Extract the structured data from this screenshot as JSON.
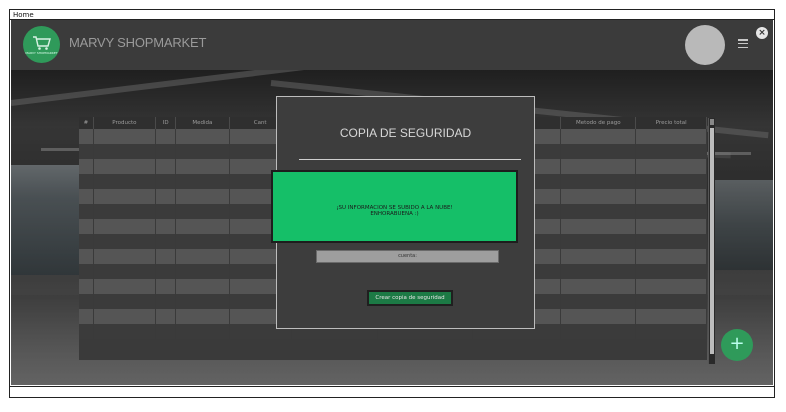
{
  "window": {
    "title": "Home"
  },
  "header": {
    "app_name": "MARVY SHOPMARKET",
    "logo_icon": "cart-icon",
    "logo_text": "MARVY SHOPMARKET",
    "avatar_icon": "avatar",
    "menu_icon": "hamburger-menu-icon",
    "close_icon": "close-icon",
    "close_glyph": "×"
  },
  "table": {
    "columns": [
      "#",
      "Producto",
      "ID",
      "Medida",
      "Cant",
      "",
      "",
      "",
      "Metodo de pago",
      "Precio total"
    ],
    "row_count": 14
  },
  "modal": {
    "title": "COPIA DE SEGURIDAD",
    "account_label": "cuenta:",
    "button_label": "Crear copia de seguridad"
  },
  "toast": {
    "line1": "¡SU INFORMACION SE SUBIDO A LA NUBE!",
    "line2": "ENHORABUENA :)"
  },
  "fab": {
    "label": "+",
    "icon": "plus-icon"
  },
  "colors": {
    "accent": "#2f9a5a",
    "toast": "#15bf68",
    "header": "#3b3b3b"
  }
}
